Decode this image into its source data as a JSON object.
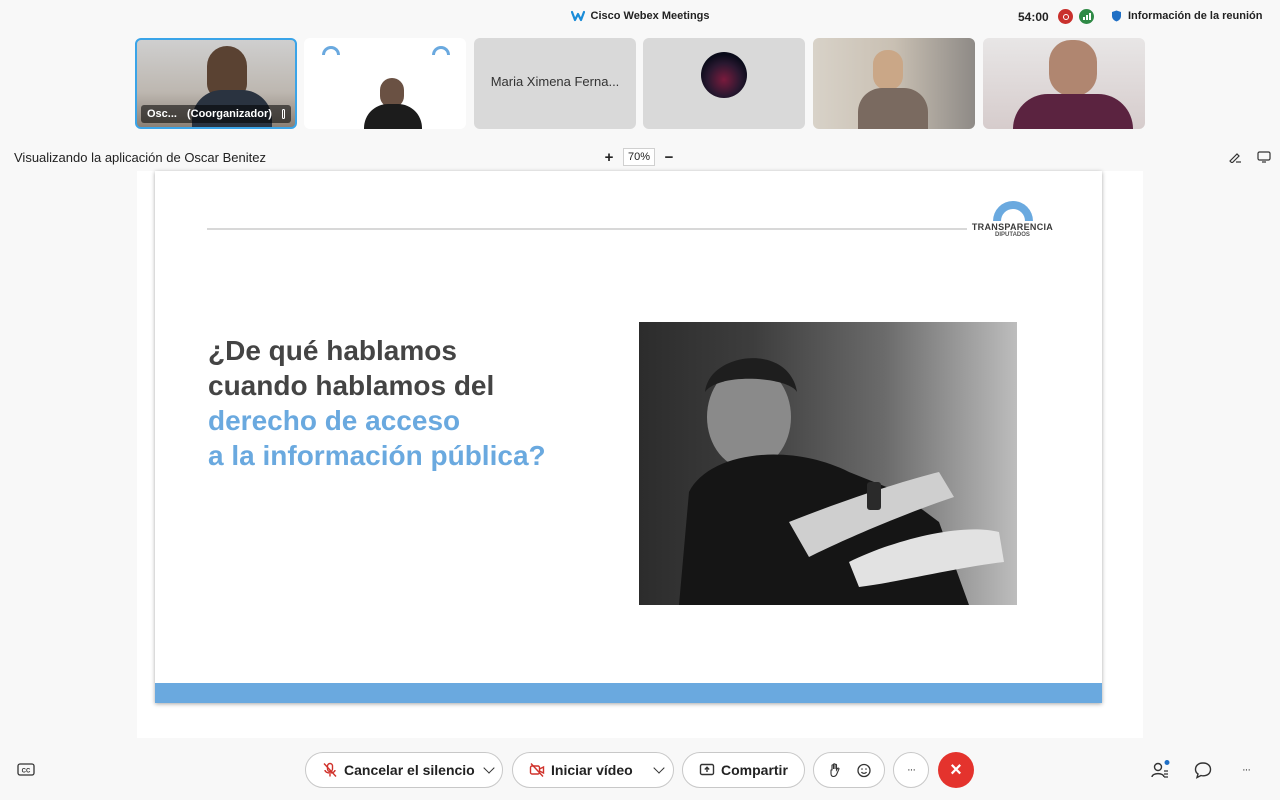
{
  "window": {
    "title": "Cisco Webex Meetings",
    "timer": "54:00",
    "meeting_info": "Información de la reunión"
  },
  "participants": [
    {
      "name": "Osc...",
      "role": "(Coorganizador)"
    },
    {
      "name": ""
    },
    {
      "name": "Maria Ximena Ferna..."
    },
    {
      "name": ""
    },
    {
      "name": ""
    },
    {
      "name": ""
    }
  ],
  "share": {
    "label": "Visualizando la aplicación de Oscar Benitez",
    "zoom": "70%",
    "zoom_in": "+",
    "zoom_out": "−"
  },
  "slide": {
    "logo_main": "TRANSPARENCIA",
    "logo_sub": "DIPUTADOS",
    "title_line1": "¿De qué hablamos",
    "title_line2": "cuando hablamos del",
    "title_line3": "derecho de acceso",
    "title_line4": "a la información pública?",
    "accent_color": "#6aa9df"
  },
  "controls": {
    "mute_label": "Cancelar el silencio",
    "video_label": "Iniciar vídeo",
    "share_label": "Compartir",
    "more": "···",
    "end": "×",
    "end_color": "#e4332d"
  }
}
